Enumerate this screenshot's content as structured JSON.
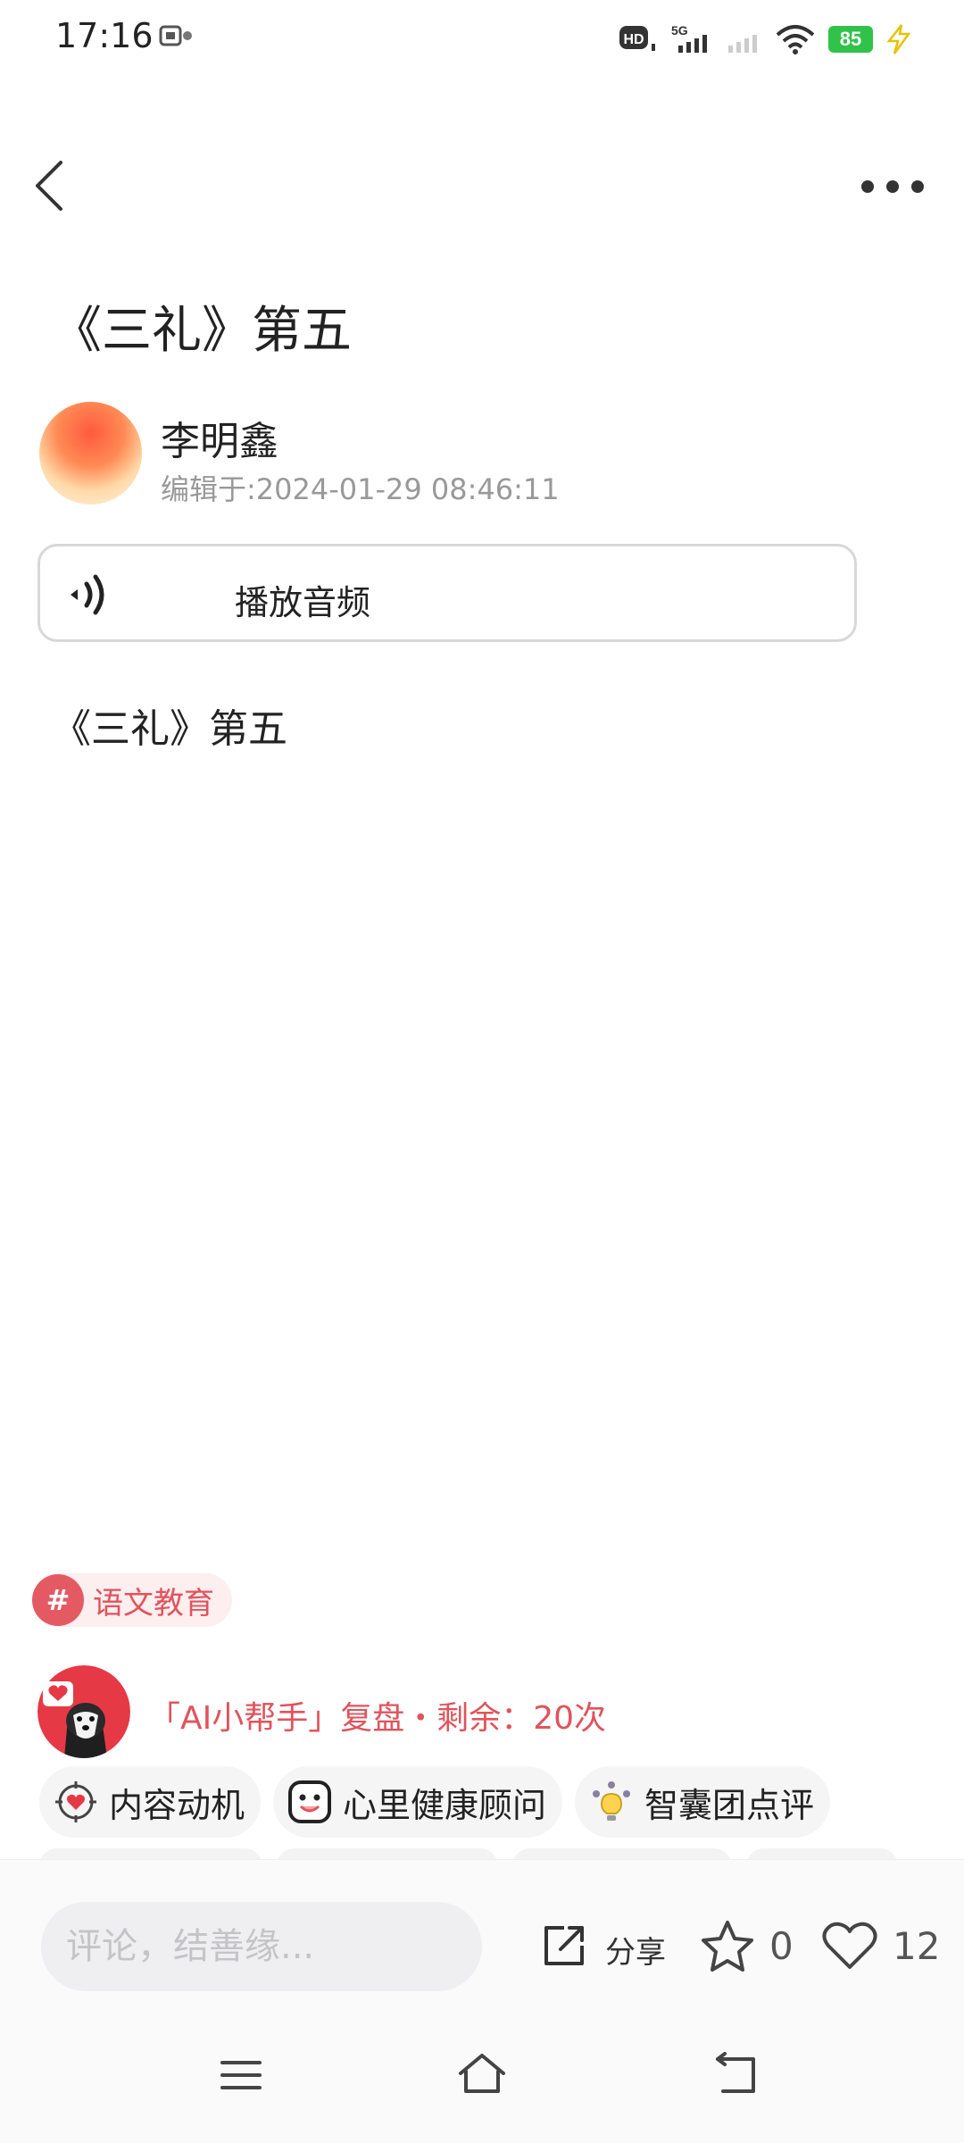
{
  "status_bar": {
    "time": "17:16",
    "battery": "85",
    "icons": [
      "screen-cast-icon",
      "hd-icon",
      "5g-signal-icon",
      "signal-icon",
      "wifi-icon",
      "battery-icon",
      "charging-icon"
    ]
  },
  "header": {
    "back_icon": "chevron-left-icon",
    "more_icon": "more-dots-icon"
  },
  "article": {
    "title": "《三礼》第五",
    "author": "李明鑫",
    "edited": "编辑于:2024-01-29 08:46:11",
    "audio_label": "播放音频",
    "body": "《三礼》第五"
  },
  "tag": {
    "hash": "#",
    "label": "语文教育"
  },
  "ai_helper": {
    "text": "「AI小帮手」复盘・剩余：20次",
    "chips": [
      {
        "label": "内容动机",
        "icon": "target-heart-icon"
      },
      {
        "label": "心里健康顾问",
        "icon": "smile-face-icon"
      },
      {
        "label": "智囊团点评",
        "icon": "lightbulb-team-icon"
      }
    ]
  },
  "bottom_bar": {
    "comment_placeholder": "评论，结善缘...",
    "share_label": "分享",
    "star_count": "0",
    "like_count": "12"
  },
  "colors": {
    "accent_red": "#e0545c",
    "tag_bg": "#fdeef0",
    "battery_green": "#31c24a"
  }
}
